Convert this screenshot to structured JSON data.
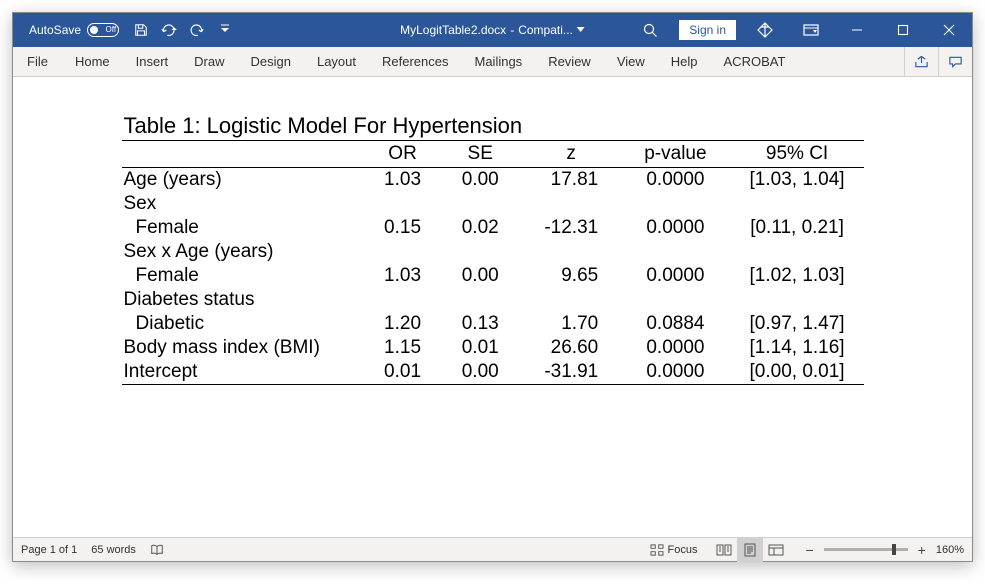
{
  "titlebar": {
    "autosave_label": "AutoSave",
    "autosave_state": "Off",
    "filename": "MyLogitTable2.docx",
    "compat": "Compati...",
    "signin": "Sign in"
  },
  "ribbon": {
    "tabs": [
      "File",
      "Home",
      "Insert",
      "Draw",
      "Design",
      "Layout",
      "References",
      "Mailings",
      "Review",
      "View",
      "Help",
      "ACROBAT"
    ]
  },
  "chart_data": {
    "type": "table",
    "title": "Table 1: Logistic Model For Hypertension",
    "columns": [
      "",
      "OR",
      "SE",
      "z",
      "p-value",
      "95% CI"
    ],
    "rows": [
      {
        "label": "Age (years)",
        "indent": 0,
        "OR": "1.03",
        "SE": "0.00",
        "z": "17.81",
        "p": "0.0000",
        "CI": "[1.03, 1.04]"
      },
      {
        "label": "Sex",
        "indent": 0,
        "OR": "",
        "SE": "",
        "z": "",
        "p": "",
        "CI": ""
      },
      {
        "label": "Female",
        "indent": 1,
        "OR": "0.15",
        "SE": "0.02",
        "z": "-12.31",
        "p": "0.0000",
        "CI": "[0.11, 0.21]"
      },
      {
        "label": "Sex x Age (years)",
        "indent": 0,
        "OR": "",
        "SE": "",
        "z": "",
        "p": "",
        "CI": ""
      },
      {
        "label": "Female",
        "indent": 1,
        "OR": "1.03",
        "SE": "0.00",
        "z": "9.65",
        "p": "0.0000",
        "CI": "[1.02, 1.03]"
      },
      {
        "label": "Diabetes status",
        "indent": 0,
        "OR": "",
        "SE": "",
        "z": "",
        "p": "",
        "CI": ""
      },
      {
        "label": "Diabetic",
        "indent": 1,
        "OR": "1.20",
        "SE": "0.13",
        "z": "1.70",
        "p": "0.0884",
        "CI": "[0.97, 1.47]"
      },
      {
        "label": "Body mass index (BMI)",
        "indent": 0,
        "OR": "1.15",
        "SE": "0.01",
        "z": "26.60",
        "p": "0.0000",
        "CI": "[1.14, 1.16]"
      },
      {
        "label": "Intercept",
        "indent": 0,
        "OR": "0.01",
        "SE": "0.00",
        "z": "-31.91",
        "p": "0.0000",
        "CI": "[0.00, 0.01]"
      }
    ]
  },
  "status": {
    "page": "Page 1 of 1",
    "words": "65 words",
    "focus": "Focus",
    "zoom": "160%"
  }
}
